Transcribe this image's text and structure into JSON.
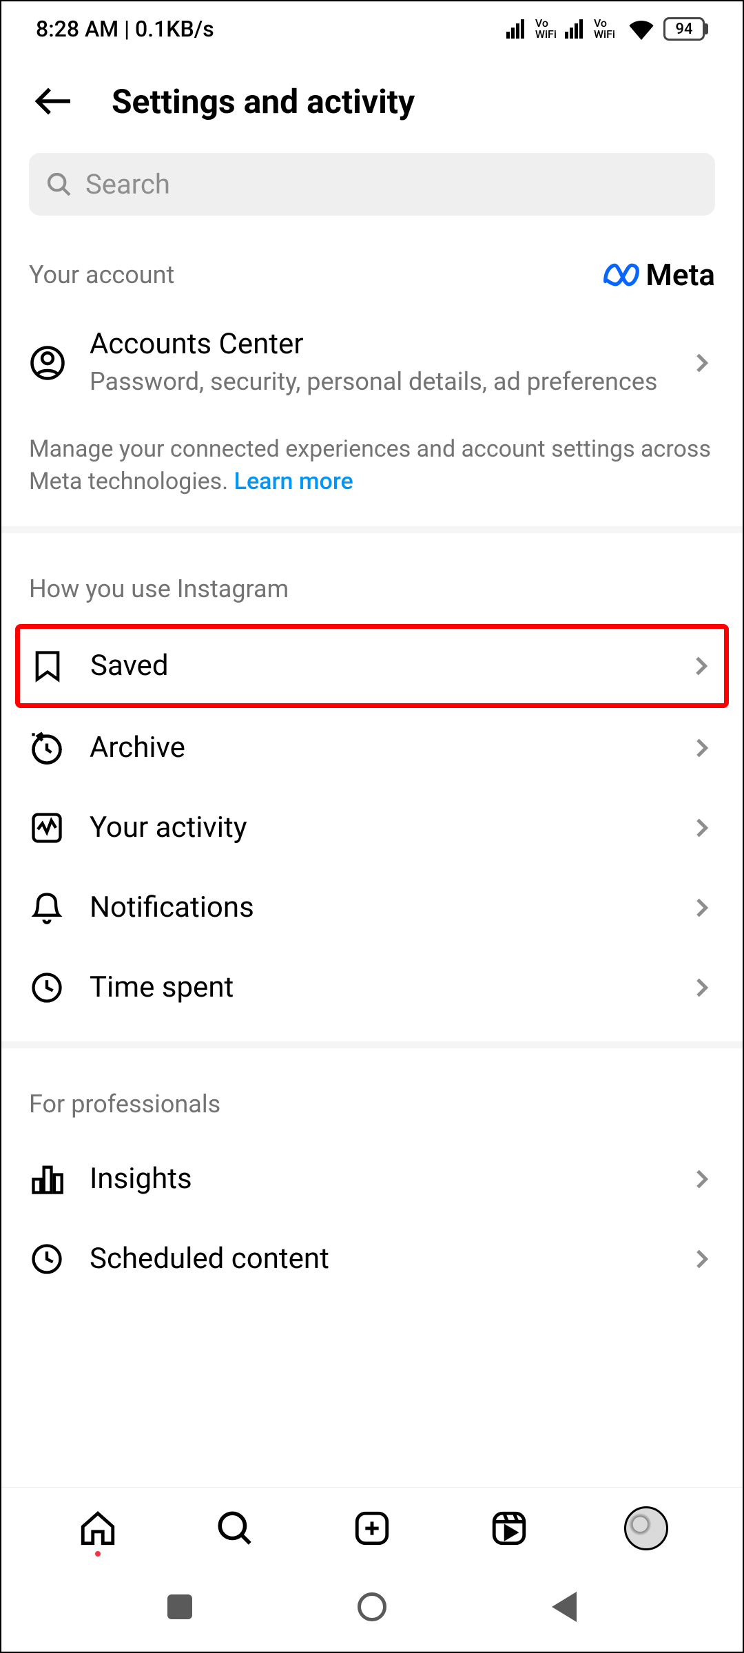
{
  "status": {
    "time": "8:28 AM",
    "speed": "0.1KB/s",
    "vowifi": "Vo\nWiFi",
    "battery": "94"
  },
  "header": {
    "title": "Settings and activity"
  },
  "search": {
    "placeholder": "Search"
  },
  "sections": {
    "account": {
      "title": "Your account",
      "brand": "Meta",
      "item_title": "Accounts Center",
      "item_subtitle": "Password, security, personal details, ad preferences",
      "description": "Manage your connected experiences and account settings across Meta technologies. ",
      "learn_more": "Learn more"
    },
    "usage": {
      "title": "How you use Instagram",
      "items": [
        {
          "label": "Saved",
          "icon": "bookmark",
          "highlighted": true
        },
        {
          "label": "Archive",
          "icon": "archive"
        },
        {
          "label": "Your activity",
          "icon": "activity"
        },
        {
          "label": "Notifications",
          "icon": "bell"
        },
        {
          "label": "Time spent",
          "icon": "clock"
        }
      ]
    },
    "professionals": {
      "title": "For professionals",
      "items": [
        {
          "label": "Insights",
          "icon": "chart"
        },
        {
          "label": "Scheduled content",
          "icon": "clock"
        }
      ]
    }
  }
}
